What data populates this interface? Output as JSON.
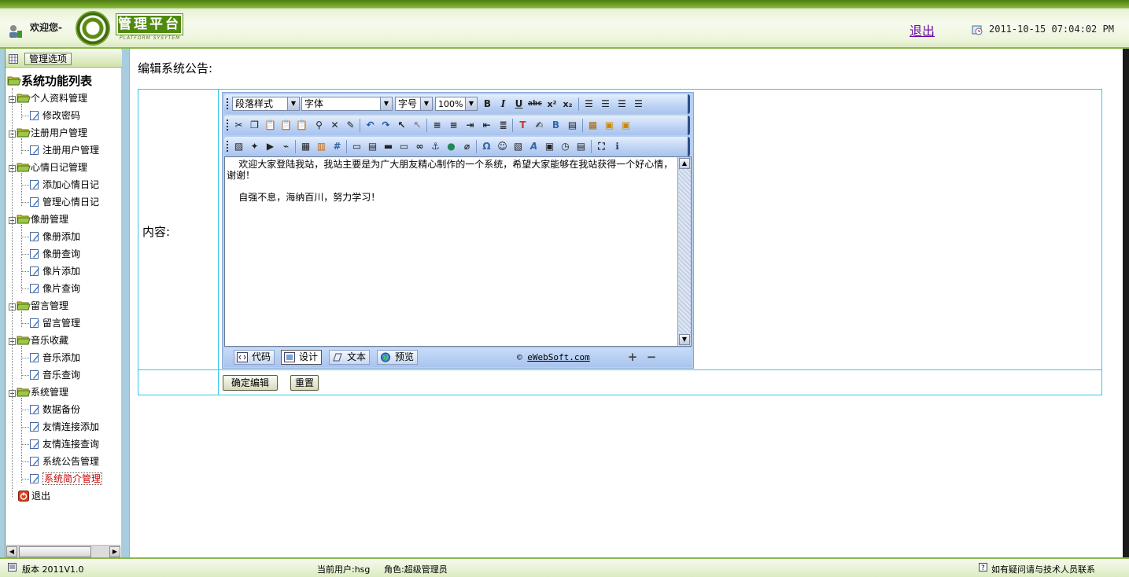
{
  "header": {
    "welcome": "欢迎您-",
    "logo_title": "管理平台",
    "logo_sub": "PLATFORM SYSYTEM",
    "logout": "退出",
    "datetime": "2011-10-15 07:04:02 PM"
  },
  "sidebar": {
    "menu_button": "管理选项",
    "tree_title": "系统功能列表",
    "groups": [
      {
        "label": "个人资料管理",
        "items": [
          "修改密码"
        ]
      },
      {
        "label": "注册用户管理",
        "items": [
          "注册用户管理"
        ]
      },
      {
        "label": "心情日记管理",
        "items": [
          "添加心情日记",
          "管理心情日记"
        ]
      },
      {
        "label": "像册管理",
        "items": [
          "像册添加",
          "像册查询",
          "像片添加",
          "像片查询"
        ]
      },
      {
        "label": "留言管理",
        "items": [
          "留言管理"
        ]
      },
      {
        "label": "音乐收藏",
        "items": [
          "音乐添加",
          "音乐查询"
        ]
      },
      {
        "label": "系统管理",
        "items": [
          "数据备份",
          "友情连接添加",
          "友情连接查询",
          "系统公告管理",
          "系统简介管理"
        ]
      }
    ],
    "exit": "退出",
    "active_item": "系统简介管理"
  },
  "main": {
    "title": "编辑系统公告:",
    "content_label": "内容:",
    "editor": {
      "paragraph_style": "段落样式",
      "font": "字体",
      "font_size": "字号",
      "zoom": "100%",
      "text_line1": "    欢迎大家登陆我站，我站主要是为广大朋友精心制作的一个系统，希望大家能够在我站获得一个好心情，谢谢！",
      "text_line2": "    自强不息，海纳百川，努力学习！",
      "mode_tabs": [
        "代码",
        "设计",
        "文本",
        "预览"
      ],
      "active_mode": "设计",
      "copyright_prefix": "© ",
      "copyright_link": "eWebSoft.com"
    },
    "submit": "确定编辑",
    "reset": "重置"
  },
  "footer": {
    "version": "版本 2011V1.0",
    "current_user": "当前用户:hsg",
    "role": "角色:超级管理员",
    "help": "如有疑问请与技术人员联系"
  },
  "colors": {
    "header_green": "#6a9a20",
    "table_border": "#32c8e8",
    "editor_blue": "#b8cff0",
    "link_purple": "#6b0aa8",
    "active_red": "#cc0000"
  }
}
